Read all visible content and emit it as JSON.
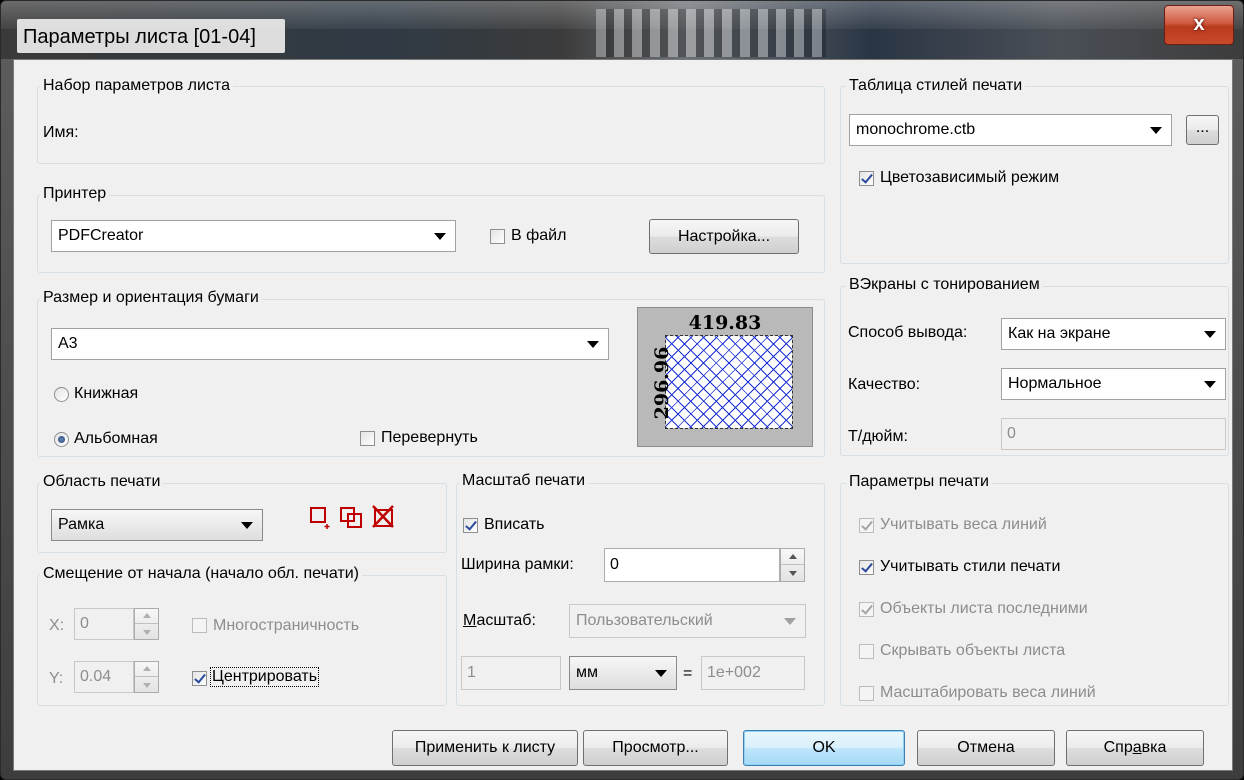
{
  "window": {
    "title": "Параметры листа [01-04]",
    "close_glyph": "x"
  },
  "pagesetup": {
    "group_label": "Набор параметров листа",
    "name_label": "Имя:"
  },
  "printer": {
    "group_label": "Принтер",
    "name": "PDFCreator",
    "to_file_label": "В файл",
    "to_file_checked": false,
    "setup_button": "Настройка..."
  },
  "paper": {
    "group_label": "Размер и ориентация бумаги",
    "size": "A3",
    "portrait_label": "Книжная",
    "landscape_label": "Альбомная",
    "orientation": "landscape",
    "flip_label": "Перевернуть",
    "flip_checked": false,
    "preview_width": "419.83",
    "preview_height": "296.96"
  },
  "plot_area": {
    "group_label": "Область печати",
    "value": "Рамка",
    "icons": [
      "window-select-icon",
      "window-copy-icon",
      "window-delete-icon"
    ]
  },
  "offset": {
    "group_label": "Смещение от начала (начало обл. печати)",
    "x_label": "X:",
    "x_value": "0",
    "y_label": "Y:",
    "y_value": "0.04",
    "multipage_label": "Многостраничность",
    "center_label": "Центрировать",
    "center_checked": true
  },
  "scale": {
    "group_label": "Масштаб печати",
    "fit_label": "Вписать",
    "fit_checked": true,
    "frame_width_label": "Ширина рамки:",
    "frame_width_value": "0",
    "scale_label": "Масштаб:",
    "scale_value": "Пользовательский",
    "units_value": "1",
    "unit": "мм",
    "equals": "=",
    "drawing_units": "1e+002"
  },
  "style_table": {
    "group_label": "Таблица стилей печати",
    "value": "monochrome.ctb",
    "browse_button": "...",
    "color_dependent_label": "Цветозависимый режим",
    "color_dependent_checked": true
  },
  "shaded": {
    "group_label": "ВЭкраны с тонированием",
    "output_label": "Способ вывода:",
    "output_value": "Как на экране",
    "quality_label": "Качество:",
    "quality_value": "Нормальное",
    "dpi_label": "Т/дюйм:",
    "dpi_value": "0"
  },
  "options": {
    "group_label": "Параметры печати",
    "items": [
      {
        "label": "Учитывать веса линий",
        "checked": true,
        "enabled": false
      },
      {
        "label": "Учитывать стили печати",
        "checked": true,
        "enabled": true
      },
      {
        "label": "Объекты листа последними",
        "checked": true,
        "enabled": false
      },
      {
        "label": "Скрывать объекты листа",
        "checked": false,
        "enabled": false
      },
      {
        "label": "Масштабировать веса линий",
        "checked": false,
        "enabled": false
      }
    ]
  },
  "buttons": {
    "apply": "Применить к листу",
    "preview": "Просмотр...",
    "ok": "OK",
    "cancel": "Отмена",
    "help": "Справка"
  },
  "colors": {
    "accent": "#1b2fd6",
    "close": "#c94a2a",
    "default_button": "#a7d9f5"
  }
}
